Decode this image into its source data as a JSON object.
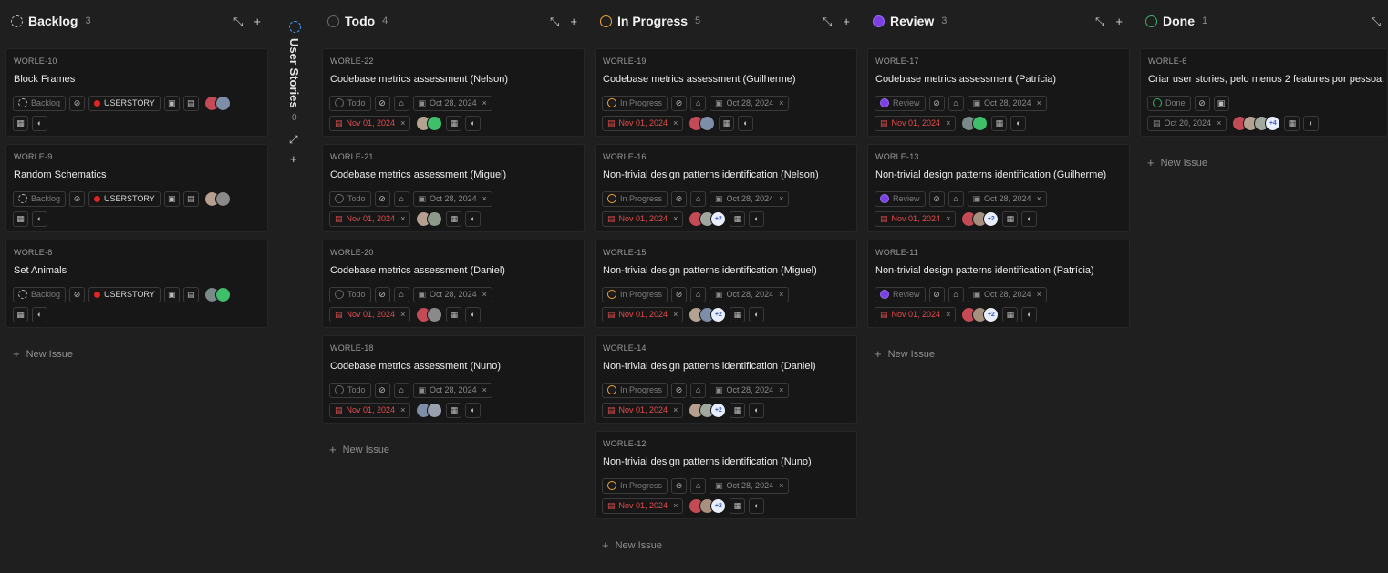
{
  "collapsed_group": {
    "title": "User Stories",
    "count": "0"
  },
  "columns": [
    {
      "key": "backlog",
      "title": "Backlog",
      "count": "3",
      "status_label": "Backlog",
      "new_issue": "New Issue",
      "cards": [
        {
          "id": "WORLE-10",
          "title": "Block Frames",
          "label": "USERSTORY",
          "avatars": [
            "#c44a55",
            "#7d8ea8"
          ]
        },
        {
          "id": "WORLE-9",
          "title": "Random Schematics",
          "label": "USERSTORY",
          "avatars": [
            "#b79f90",
            "#8a8a8a"
          ]
        },
        {
          "id": "WORLE-8",
          "title": "Set Animals",
          "label": "USERSTORY",
          "avatars": [
            "#7a8a8a",
            "#3fbf6a"
          ]
        }
      ]
    },
    {
      "key": "todo",
      "title": "Todo",
      "count": "4",
      "status_label": "Todo",
      "new_issue": "New Issue",
      "cards": [
        {
          "id": "WORLE-22",
          "title": "Codebase metrics assessment (Nelson)",
          "start": "Oct 28, 2024",
          "due": "Nov 01, 2024",
          "avatars": [
            "#b3a390",
            "#3fbf6a"
          ]
        },
        {
          "id": "WORLE-21",
          "title": "Codebase metrics assessment (Miguel)",
          "start": "Oct 28, 2024",
          "due": "Nov 01, 2024",
          "avatars": [
            "#b79f90",
            "#8b9a8a"
          ]
        },
        {
          "id": "WORLE-20",
          "title": "Codebase metrics assessment (Daniel)",
          "start": "Oct 28, 2024",
          "due": "Nov 01, 2024",
          "avatars": [
            "#c44a55",
            "#8a8a8a"
          ]
        },
        {
          "id": "WORLE-18",
          "title": "Codebase metrics assessment (Nuno)",
          "start": "Oct 28, 2024",
          "due": "Nov 01, 2024",
          "avatars": [
            "#7d8ea8",
            "#9aa0b0"
          ]
        }
      ]
    },
    {
      "key": "progress",
      "title": "In Progress",
      "count": "5",
      "status_label": "In Progress",
      "new_issue": "New Issue",
      "cards": [
        {
          "id": "WORLE-19",
          "title": "Codebase metrics assessment (Guilherme)",
          "start": "Oct 28, 2024",
          "due": "Nov 01, 2024",
          "avatars": [
            "#c44a55",
            "#7d8ea8"
          ]
        },
        {
          "id": "WORLE-16",
          "title": "Non-trivial design patterns identification (Nelson)",
          "start": "Oct 28, 2024",
          "due": "Nov 01, 2024",
          "avatars": [
            "#c44a55",
            "#a0a8a0",
            "#e8eefc"
          ],
          "more": "+2"
        },
        {
          "id": "WORLE-15",
          "title": "Non-trivial design patterns identification (Miguel)",
          "start": "Oct 28, 2024",
          "due": "Nov 01, 2024",
          "avatars": [
            "#b3a390",
            "#7d8ea8",
            "#e8eefc"
          ],
          "more": "+2"
        },
        {
          "id": "WORLE-14",
          "title": "Non-trivial design patterns identification (Daniel)",
          "start": "Oct 28, 2024",
          "due": "Nov 01, 2024",
          "avatars": [
            "#b79f90",
            "#a0a8a0",
            "#e8eefc"
          ],
          "more": "+2"
        },
        {
          "id": "WORLE-12",
          "title": "Non-trivial design patterns identification (Nuno)",
          "start": "Oct 28, 2024",
          "due": "Nov 01, 2024",
          "avatars": [
            "#c44a55",
            "#a89080",
            "#e8eefc"
          ],
          "more": "+2"
        }
      ]
    },
    {
      "key": "review",
      "title": "Review",
      "count": "3",
      "status_label": "Review",
      "new_issue": "New Issue",
      "cards": [
        {
          "id": "WORLE-17",
          "title": "Codebase metrics assessment (Patrícia)",
          "start": "Oct 28, 2024",
          "due": "Nov 01, 2024",
          "avatars": [
            "#7a8a8a",
            "#3fbf6a"
          ]
        },
        {
          "id": "WORLE-13",
          "title": "Non-trivial design patterns identification (Guilherme)",
          "start": "Oct 28, 2024",
          "due": "Nov 01, 2024",
          "avatars": [
            "#c44a55",
            "#a89080",
            "#e8eefc"
          ],
          "more": "+2"
        },
        {
          "id": "WORLE-11",
          "title": "Non-trivial design patterns identification (Patrícia)",
          "start": "Oct 28, 2024",
          "due": "Nov 01, 2024",
          "avatars": [
            "#c44a55",
            "#a89080",
            "#e8eefc"
          ],
          "more": "+2"
        }
      ]
    },
    {
      "key": "done",
      "title": "Done",
      "count": "1",
      "status_label": "Done",
      "new_issue": "New Issue",
      "cards": [
        {
          "id": "WORLE-6",
          "title": "Criar user stories, pelo menos 2 features por pessoa.",
          "start_only": "Oct 20, 2024",
          "avatars": [
            "#c44a55",
            "#b3a390",
            "#a0a8a0",
            "#e8eefc"
          ],
          "more": "+4"
        }
      ]
    }
  ]
}
